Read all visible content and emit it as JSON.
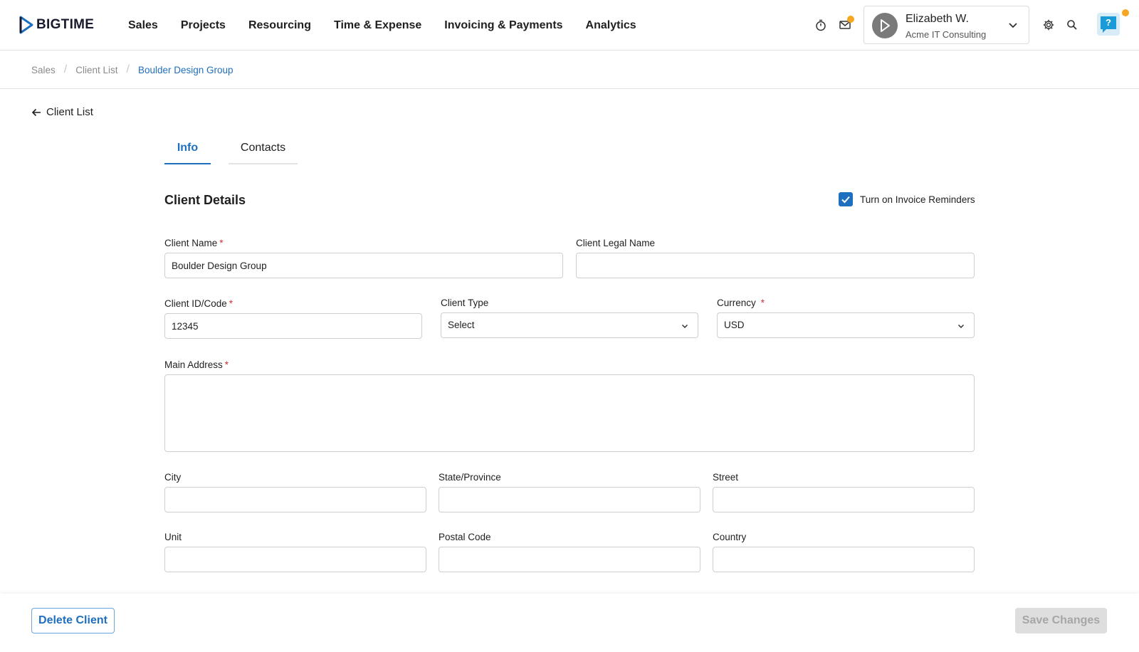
{
  "brand": {
    "name": "BIGTIME",
    "accent": "#1f6fbf",
    "notification_color": "#f5a623"
  },
  "nav": {
    "items": [
      "Sales",
      "Projects",
      "Resourcing",
      "Time & Expense",
      "Invoicing & Payments",
      "Analytics"
    ]
  },
  "header_icons": [
    "timer-icon",
    "mail-icon",
    "gear-icon",
    "search-icon",
    "help-icon"
  ],
  "user": {
    "name": "Elizabeth W.",
    "org": "Acme IT Consulting"
  },
  "breadcrumb": [
    "Sales",
    "Client List",
    "Boulder Design Group"
  ],
  "back_link": {
    "label": "Client List"
  },
  "tabs": [
    {
      "label": "Info",
      "active": true
    },
    {
      "label": "Contacts",
      "active": false
    }
  ],
  "section": {
    "title": "Client Details",
    "invoice_reminders": {
      "label": "Turn on Invoice Reminders",
      "checked": true
    }
  },
  "form": {
    "client_name": {
      "label": "Client Name",
      "required": "*",
      "value": "Boulder Design Group"
    },
    "client_legal_name": {
      "label": "Client Legal Name",
      "value": ""
    },
    "client_id": {
      "label": "Client ID/Code",
      "required": "*",
      "value": "12345"
    },
    "client_type": {
      "label": "Client Type",
      "value": "Select"
    },
    "currency": {
      "label": "Currency",
      "required": "*",
      "value": "USD"
    },
    "main_address": {
      "label": "Main Address",
      "required": "*",
      "value": ""
    },
    "city": {
      "label": "City",
      "value": ""
    },
    "state": {
      "label": "State/Province",
      "value": ""
    },
    "street": {
      "label": "Street",
      "value": ""
    },
    "unit": {
      "label": "Unit",
      "value": ""
    },
    "postal_code": {
      "label": "Postal Code",
      "value": ""
    },
    "country": {
      "label": "Country",
      "value": ""
    }
  },
  "footer": {
    "delete_label": "Delete Client",
    "save_label": "Save Changes"
  }
}
